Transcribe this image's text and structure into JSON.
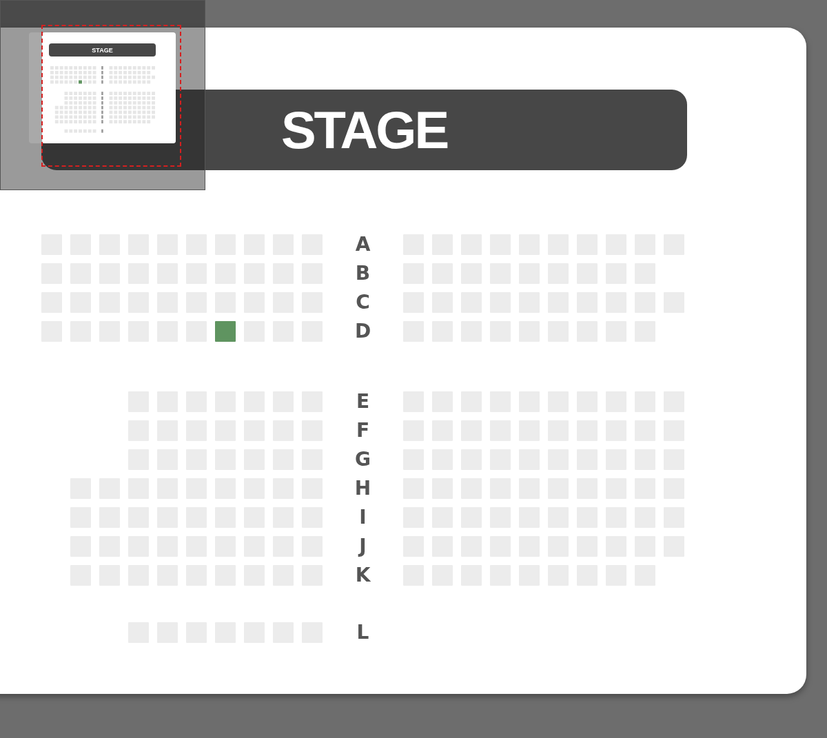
{
  "minimap": {
    "stage_label": "STAGE"
  },
  "stage": {
    "label": "STAGE"
  },
  "sections": [
    {
      "rows": [
        {
          "label": "A",
          "left": [
            {
              "selected": false
            },
            {
              "selected": false
            },
            {
              "selected": false
            },
            {
              "selected": false
            },
            {
              "selected": false
            },
            {
              "selected": false
            },
            {
              "selected": false
            },
            {
              "selected": false
            },
            {
              "selected": false
            },
            {
              "selected": false
            }
          ],
          "right": [
            {
              "selected": false
            },
            {
              "selected": false
            },
            {
              "selected": false
            },
            {
              "selected": false
            },
            {
              "selected": false
            },
            {
              "selected": false
            },
            {
              "selected": false
            },
            {
              "selected": false
            },
            {
              "selected": false
            },
            {
              "selected": false
            }
          ]
        },
        {
          "label": "B",
          "left": [
            {
              "selected": false
            },
            {
              "selected": false
            },
            {
              "selected": false
            },
            {
              "selected": false
            },
            {
              "selected": false
            },
            {
              "selected": false
            },
            {
              "selected": false
            },
            {
              "selected": false
            },
            {
              "selected": false
            },
            {
              "selected": false
            }
          ],
          "right": [
            {
              "selected": false
            },
            {
              "selected": false
            },
            {
              "selected": false
            },
            {
              "selected": false
            },
            {
              "selected": false
            },
            {
              "selected": false
            },
            {
              "selected": false
            },
            {
              "selected": false
            },
            {
              "selected": false
            }
          ]
        },
        {
          "label": "C",
          "left": [
            {
              "selected": false
            },
            {
              "selected": false
            },
            {
              "selected": false
            },
            {
              "selected": false
            },
            {
              "selected": false
            },
            {
              "selected": false
            },
            {
              "selected": false
            },
            {
              "selected": false
            },
            {
              "selected": false
            },
            {
              "selected": false
            }
          ],
          "right": [
            {
              "selected": false
            },
            {
              "selected": false
            },
            {
              "selected": false
            },
            {
              "selected": false
            },
            {
              "selected": false
            },
            {
              "selected": false
            },
            {
              "selected": false
            },
            {
              "selected": false
            },
            {
              "selected": false
            },
            {
              "selected": false
            }
          ]
        },
        {
          "label": "D",
          "left": [
            {
              "selected": false
            },
            {
              "selected": false
            },
            {
              "selected": false
            },
            {
              "selected": false
            },
            {
              "selected": false
            },
            {
              "selected": false
            },
            {
              "selected": true
            },
            {
              "selected": false
            },
            {
              "selected": false
            },
            {
              "selected": false
            }
          ],
          "right": [
            {
              "selected": false
            },
            {
              "selected": false
            },
            {
              "selected": false
            },
            {
              "selected": false
            },
            {
              "selected": false
            },
            {
              "selected": false
            },
            {
              "selected": false
            },
            {
              "selected": false
            },
            {
              "selected": false
            }
          ]
        }
      ]
    },
    {
      "rows": [
        {
          "label": "E",
          "left": [
            {
              "selected": false
            },
            {
              "selected": false
            },
            {
              "selected": false
            },
            {
              "selected": false
            },
            {
              "selected": false
            },
            {
              "selected": false
            },
            {
              "selected": false
            }
          ],
          "right": [
            {
              "selected": false
            },
            {
              "selected": false
            },
            {
              "selected": false
            },
            {
              "selected": false
            },
            {
              "selected": false
            },
            {
              "selected": false
            },
            {
              "selected": false
            },
            {
              "selected": false
            },
            {
              "selected": false
            },
            {
              "selected": false
            }
          ]
        },
        {
          "label": "F",
          "left": [
            {
              "selected": false
            },
            {
              "selected": false
            },
            {
              "selected": false
            },
            {
              "selected": false
            },
            {
              "selected": false
            },
            {
              "selected": false
            },
            {
              "selected": false
            }
          ],
          "right": [
            {
              "selected": false
            },
            {
              "selected": false
            },
            {
              "selected": false
            },
            {
              "selected": false
            },
            {
              "selected": false
            },
            {
              "selected": false
            },
            {
              "selected": false
            },
            {
              "selected": false
            },
            {
              "selected": false
            },
            {
              "selected": false
            }
          ]
        },
        {
          "label": "G",
          "left": [
            {
              "selected": false
            },
            {
              "selected": false
            },
            {
              "selected": false
            },
            {
              "selected": false
            },
            {
              "selected": false
            },
            {
              "selected": false
            },
            {
              "selected": false
            }
          ],
          "right": [
            {
              "selected": false
            },
            {
              "selected": false
            },
            {
              "selected": false
            },
            {
              "selected": false
            },
            {
              "selected": false
            },
            {
              "selected": false
            },
            {
              "selected": false
            },
            {
              "selected": false
            },
            {
              "selected": false
            },
            {
              "selected": false
            }
          ]
        },
        {
          "label": "H",
          "left": [
            {
              "selected": false
            },
            {
              "selected": false
            },
            {
              "selected": false
            },
            {
              "selected": false
            },
            {
              "selected": false
            },
            {
              "selected": false
            },
            {
              "selected": false
            },
            {
              "selected": false
            },
            {
              "selected": false
            }
          ],
          "right": [
            {
              "selected": false
            },
            {
              "selected": false
            },
            {
              "selected": false
            },
            {
              "selected": false
            },
            {
              "selected": false
            },
            {
              "selected": false
            },
            {
              "selected": false
            },
            {
              "selected": false
            },
            {
              "selected": false
            },
            {
              "selected": false
            }
          ]
        },
        {
          "label": "I",
          "left": [
            {
              "selected": false
            },
            {
              "selected": false
            },
            {
              "selected": false
            },
            {
              "selected": false
            },
            {
              "selected": false
            },
            {
              "selected": false
            },
            {
              "selected": false
            },
            {
              "selected": false
            },
            {
              "selected": false
            }
          ],
          "right": [
            {
              "selected": false
            },
            {
              "selected": false
            },
            {
              "selected": false
            },
            {
              "selected": false
            },
            {
              "selected": false
            },
            {
              "selected": false
            },
            {
              "selected": false
            },
            {
              "selected": false
            },
            {
              "selected": false
            },
            {
              "selected": false
            }
          ]
        },
        {
          "label": "J",
          "left": [
            {
              "selected": false
            },
            {
              "selected": false
            },
            {
              "selected": false
            },
            {
              "selected": false
            },
            {
              "selected": false
            },
            {
              "selected": false
            },
            {
              "selected": false
            },
            {
              "selected": false
            },
            {
              "selected": false
            }
          ],
          "right": [
            {
              "selected": false
            },
            {
              "selected": false
            },
            {
              "selected": false
            },
            {
              "selected": false
            },
            {
              "selected": false
            },
            {
              "selected": false
            },
            {
              "selected": false
            },
            {
              "selected": false
            },
            {
              "selected": false
            },
            {
              "selected": false
            }
          ]
        },
        {
          "label": "K",
          "left": [
            {
              "selected": false
            },
            {
              "selected": false
            },
            {
              "selected": false
            },
            {
              "selected": false
            },
            {
              "selected": false
            },
            {
              "selected": false
            },
            {
              "selected": false
            },
            {
              "selected": false
            },
            {
              "selected": false
            }
          ],
          "right": [
            {
              "selected": false
            },
            {
              "selected": false
            },
            {
              "selected": false
            },
            {
              "selected": false
            },
            {
              "selected": false
            },
            {
              "selected": false
            },
            {
              "selected": false
            },
            {
              "selected": false
            },
            {
              "selected": false
            }
          ]
        }
      ]
    },
    {
      "rows": [
        {
          "label": "L",
          "left": [
            {
              "selected": false
            },
            {
              "selected": false
            },
            {
              "selected": false
            },
            {
              "selected": false
            },
            {
              "selected": false
            },
            {
              "selected": false
            },
            {
              "selected": false
            }
          ]
        }
      ]
    }
  ]
}
